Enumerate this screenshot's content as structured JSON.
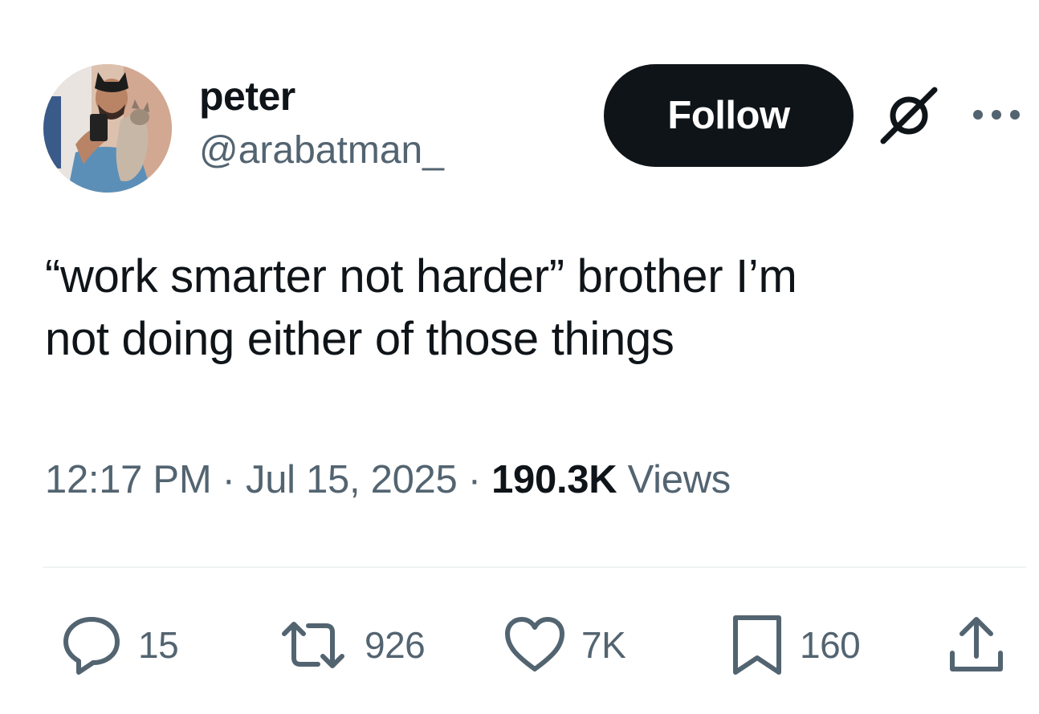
{
  "author": {
    "display_name": "peter",
    "handle": "@arabatman_"
  },
  "header": {
    "follow_label": "Follow",
    "grok_icon": "grok-icon",
    "more_icon": "more-horizontal-icon"
  },
  "tweet": {
    "text_line_1": "“work smarter not harder” brother I’m",
    "text_line_2": "not doing either of those things"
  },
  "meta": {
    "time": "12:17 PM",
    "separator": "·",
    "date": "Jul 15, 2025",
    "views_count": "190.3K",
    "views_label": "Views"
  },
  "actions": {
    "replies": "15",
    "retweets": "926",
    "likes": "7K",
    "bookmarks": "160"
  },
  "colors": {
    "text_primary": "#0f1419",
    "text_secondary": "#536471",
    "button_bg": "#0f1419",
    "divider": "#eff3f4"
  }
}
